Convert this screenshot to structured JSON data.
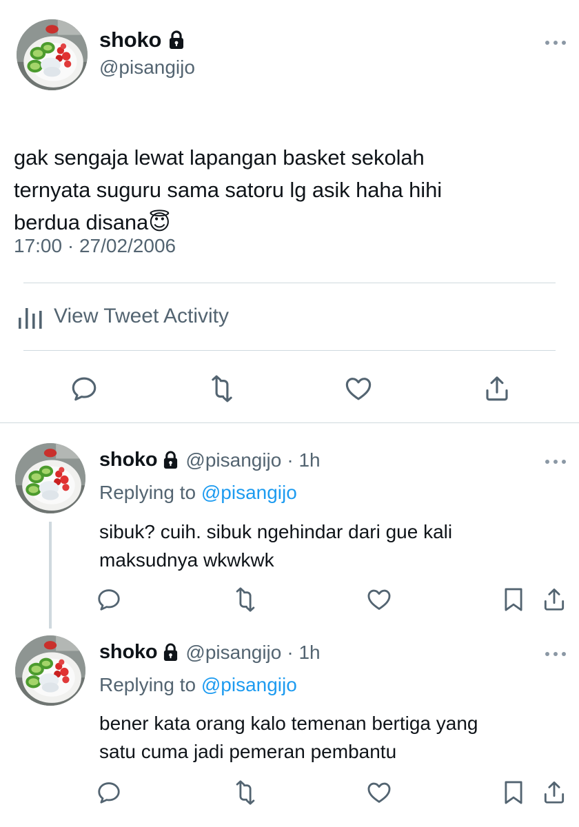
{
  "main_tweet": {
    "author_name": "shoko",
    "handle": "@pisangijo",
    "text_lines": [
      "gak sengaja lewat lapangan basket sekolah",
      "ternyata suguru sama satoru lg asik haha hihi",
      "berdua disana"
    ],
    "emoji": "😇",
    "timestamp": "17:00 · 27/02/2006",
    "activity_label": "View Tweet Activity"
  },
  "replies": [
    {
      "author_name": "shoko",
      "handle": "@pisangijo",
      "time": "· 1h",
      "replying_prefix": "Replying to",
      "replying_to": "@pisangijo",
      "text": "sibuk? cuih. sibuk ngehindar dari gue kali\nmaksudnya wkwkwk"
    },
    {
      "author_name": "shoko",
      "handle": "@pisangijo",
      "time": "· 1h",
      "replying_prefix": "Replying to",
      "replying_to": "@pisangijo",
      "text": "bener kata orang kalo temenan bertiga yang\nsatu cuma jadi pemeran pembantu"
    }
  ],
  "icons": {
    "lock": "lock-icon",
    "more": "more-icon",
    "reply": "reply-icon",
    "retweet": "retweet-icon",
    "like": "like-icon",
    "share": "share-icon",
    "bookmark": "bookmark-icon",
    "activity": "bar-chart-icon"
  },
  "colors": {
    "text": "#0f1419",
    "secondary": "#536471",
    "link": "#1d9bf0",
    "divider": "#cfd9de"
  }
}
